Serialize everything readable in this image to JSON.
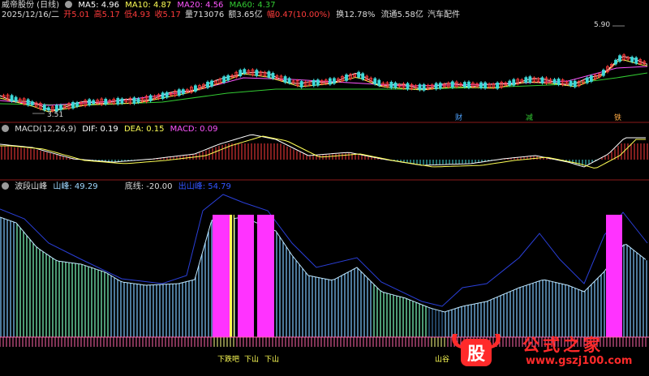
{
  "price_panel": {
    "stock_name": "威帝股份 (日线)",
    "ma5": "MA5: 4.96",
    "ma10": "MA10: 4.87",
    "ma20": "MA20: 4.56",
    "ma60": "MA60: 4.37",
    "date": "2025/12/16/二",
    "open": "开5.01",
    "high": "高5.17",
    "low": "低4.93",
    "close": "收5.17",
    "volume": "量713076",
    "amount": "额3.65亿",
    "change": "幅0.47(10.00%)",
    "turnover": "换12.78%",
    "float_cap": "流通5.58亿",
    "sector": "汽车配件",
    "high_label": "5.90",
    "low_label": "3.51",
    "mark_cai": "财",
    "mark_jian": "减",
    "mark_tie": "铁"
  },
  "macd_panel": {
    "title": "MACD(12,26,9)",
    "dif": "DIF: 0.19",
    "dea": "DEA: 0.15",
    "macd": "MACD: 0.09"
  },
  "wave_panel": {
    "title": "波段山峰",
    "peak": "山峰: 49.29",
    "bottom": "底线: -20.00",
    "exit_peak": "出山峰: 54.79",
    "labels": [
      "下跌吧",
      "下山",
      "下山",
      "山谷"
    ]
  },
  "watermark": {
    "logo_text": "股",
    "title": "公式之家",
    "url": "www.gszj100.com"
  },
  "colors": {
    "up": "#ff3b3b",
    "down": "#3fd8d8",
    "ma5": "#ffffff",
    "ma10": "#ffff55",
    "ma20": "#ff55ff",
    "ma60": "#33cc33",
    "magenta_bar": "#ff33ff",
    "wave_line": "#7fc7ff"
  }
}
